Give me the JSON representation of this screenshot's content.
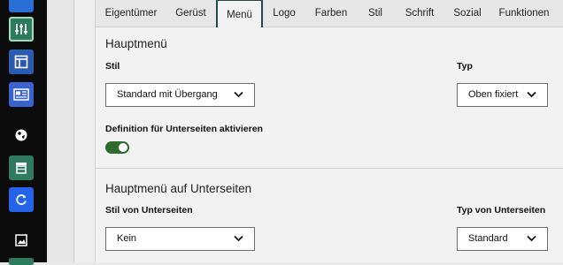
{
  "sidebar": {
    "items": [
      {
        "icon": "square-icon",
        "color": "#2a6fd6"
      },
      {
        "icon": "sliders-icon",
        "color": "#2f7a5f"
      },
      {
        "icon": "layout-icon",
        "color": "#2a5bb0"
      },
      {
        "icon": "newspaper-icon",
        "color": "#3a63d0"
      },
      {
        "icon": "globe-icon",
        "color": "#0b0b0b"
      },
      {
        "icon": "shop-icon",
        "color": "#2f7a5f"
      },
      {
        "icon": "refresh-icon",
        "color": "#2563eb"
      },
      {
        "icon": "image-icon",
        "color": "#0b0b0b"
      }
    ]
  },
  "tabs": [
    {
      "label": "Eigentümer",
      "active": false
    },
    {
      "label": "Gerüst",
      "active": false
    },
    {
      "label": "Menü",
      "active": true
    },
    {
      "label": "Logo",
      "active": false
    },
    {
      "label": "Farben",
      "active": false
    },
    {
      "label": "Stil",
      "active": false
    },
    {
      "label": "Schrift",
      "active": false
    },
    {
      "label": "Sozial",
      "active": false
    },
    {
      "label": "Funktionen",
      "active": false
    }
  ],
  "main_menu": {
    "title": "Hauptmenü",
    "style_label": "Stil",
    "style_value": "Standard mit Übergang",
    "type_label": "Typ",
    "type_value": "Oben fixiert",
    "subpages_toggle_label": "Definition für Unterseiten aktivieren",
    "subpages_toggle_on": true
  },
  "subpages_menu": {
    "title": "Hauptmenü auf Unterseiten",
    "style_label": "Stil von Unterseiten",
    "style_value": "Kein",
    "type_label": "Typ von Unterseiten",
    "type_value": "Standard"
  },
  "colors": {
    "active_tab_border": "#234a47",
    "toggle_on": "#2f6b2c"
  }
}
